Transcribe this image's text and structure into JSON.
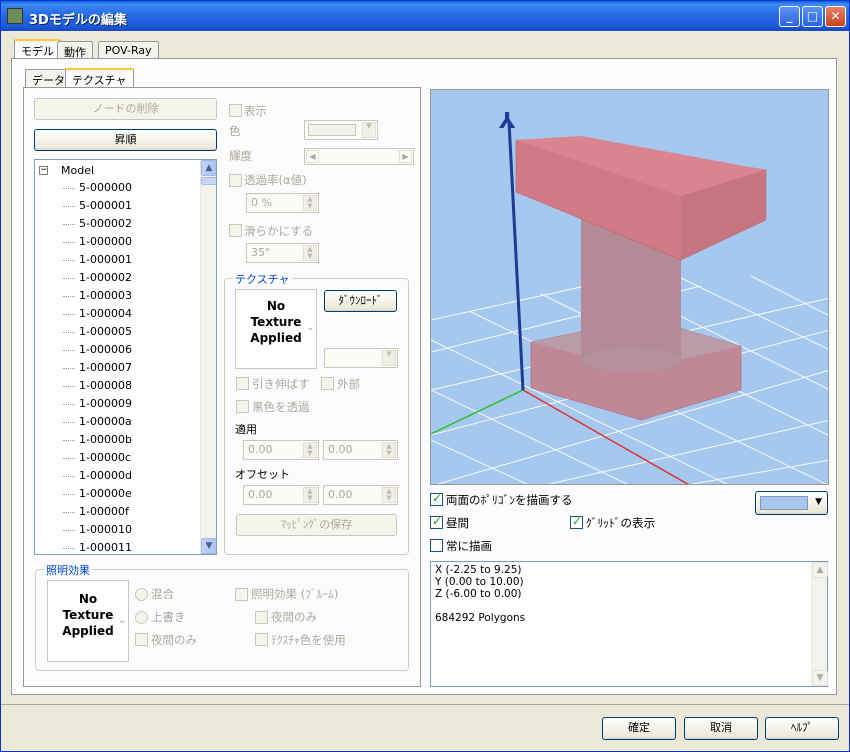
{
  "window": {
    "title": "3Dモデルの編集",
    "min": "_",
    "max": "□",
    "close": "✕"
  },
  "tabs_top": [
    "モデル",
    "動作",
    "POV-Ray"
  ],
  "tabs_inner": [
    "データ",
    "テクスチャ"
  ],
  "left": {
    "delete_node": "ノードの削除",
    "ascending": "昇順",
    "tree_root": "Model",
    "tree_items": [
      "5-000000",
      "5-000001",
      "5-000002",
      "1-000000",
      "1-000001",
      "1-000002",
      "1-000003",
      "1-000004",
      "1-000005",
      "1-000006",
      "1-000007",
      "1-000008",
      "1-000009",
      "1-00000a",
      "1-00000b",
      "1-00000c",
      "1-00000d",
      "1-00000e",
      "1-00000f",
      "1-000010",
      "1-000011"
    ]
  },
  "props": {
    "show": "表示",
    "color": "色",
    "brightness": "輝度",
    "transparency": "透過率(α値)",
    "transparency_val": "0 %",
    "smooth": "滑らかにする",
    "smooth_val": "35°"
  },
  "texture": {
    "group": "テクスチャ",
    "no_texture_l1": "No",
    "no_texture_l2": "Texture",
    "no_texture_l3": "Applied",
    "download": "ﾀﾞｳﾝﾛｰﾄﾞ",
    "stretch": "引き伸ばす",
    "external": "外部",
    "black_transparent": "黒色を透過",
    "apply": "適用",
    "offset": "オフセット",
    "apply_x": "0.00",
    "apply_y": "0.00",
    "offset_x": "0.00",
    "offset_y": "0.00",
    "save_mapping": "ﾏｯﾋﾟﾝｸﾞの保存"
  },
  "lighting": {
    "group": "照明効果",
    "no_texture_l1": "No",
    "no_texture_l2": "Texture",
    "no_texture_l3": "Applied",
    "mix": "混合",
    "overwrite": "上書き",
    "night_only": "夜間のみ",
    "bloom": "照明効果 (ﾌﾞﾙｰﾑ)",
    "night_only2": "夜間のみ",
    "use_tex_color": "ﾃｸｽﾁｬ色を使用"
  },
  "view": {
    "both_sides": "両面のﾎﾟﾘｺﾞﾝを描画する",
    "daytime": "昼間",
    "show_grid": "ｸﾞﾘｯﾄﾞの表示",
    "always_draw": "常に描画",
    "bg_color": "#a6c8ee"
  },
  "info": {
    "x": "X (-2.25 to 9.25)",
    "y": "Y (0.00 to 10.00)",
    "z": "Z (-6.00 to 0.00)",
    "polygons": "684292 Polygons"
  },
  "footer": {
    "ok": "確定",
    "cancel": "取消",
    "help": "ﾍﾙﾌﾟ"
  }
}
